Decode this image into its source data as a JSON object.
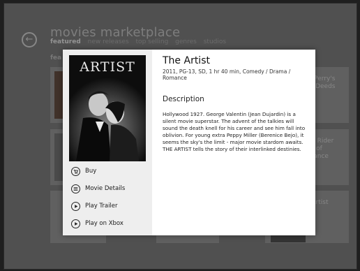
{
  "app": {
    "title": "movies marketplace",
    "back_icon": "back-arrow-icon"
  },
  "nav": {
    "items": [
      {
        "label": "featured",
        "active": true
      },
      {
        "label": "new releases",
        "active": false
      },
      {
        "label": "top selling",
        "active": false
      },
      {
        "label": "genres",
        "active": false
      },
      {
        "label": "studios",
        "active": false
      }
    ]
  },
  "section": {
    "label": "fea"
  },
  "background_tiles": {
    "right": [
      "er Perry's\nod Deeds",
      "ost Rider\nirit of\ngeance",
      "e Artist"
    ]
  },
  "modal": {
    "poster_title": "ARTIST",
    "movie_title": "The Artist",
    "meta": "2011, PG-13, SD, 1 hr 40 min, Comedy / Drama / Romance",
    "description_heading": "Description",
    "description": "Hollywood 1927. George Valentin (Jean Dujardin) is a silent movie superstar. The advent of the talkies will sound the death knell for his career and see him fall into oblivion. For young extra Peppy Miller (Berenice Bejo), it seems the sky's the limit - major movie stardom awaits. THE ARTIST tells the story of their interlinked destinies.",
    "actions": [
      {
        "label": "Buy",
        "icon": "cart-icon"
      },
      {
        "label": "Movie Details",
        "icon": "list-icon"
      },
      {
        "label": "Play Trailer",
        "icon": "play-icon"
      },
      {
        "label": "Play on Xbox",
        "icon": "play-icon"
      }
    ]
  }
}
